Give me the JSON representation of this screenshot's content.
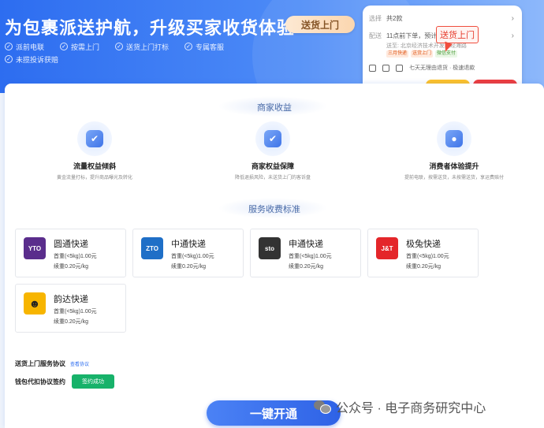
{
  "banner": {
    "title": "为包裹派送护航，升级买家收货体验",
    "tag": "送货上门",
    "features": [
      "派前电联",
      "按需上门",
      "送货上门打标",
      "专属客服",
      "未揽投诉获赔"
    ]
  },
  "phone": {
    "row1_label": "选择",
    "row1_value": "共2款",
    "row2_label": "配送",
    "row2_value": "11点前下单，预计",
    "address": "送至: 北京经济技术开发区经海路",
    "badges": [
      "三月快递",
      "送货上门",
      "微信支付"
    ],
    "bottom_text": "七天无理由退货 · 极速退款",
    "stamp": "送货上门"
  },
  "main": {
    "merchant_section_title": "商家收益",
    "benefits": [
      {
        "title": "流量权益倾斜",
        "desc": "黄金流量打标，提升商品曝光及转化"
      },
      {
        "title": "商家权益保障",
        "desc": "降低退损风险，未送货上门的客诉盘"
      },
      {
        "title": "消费者体验提升",
        "desc": "提前电联，按需送货，未按需送货，享运费赔付"
      }
    ],
    "fee_section_title": "服务收费标准",
    "couriers": [
      {
        "name": "圆通快递",
        "logo_text": "YTO",
        "line1": "首重(<5kg)1.00元",
        "line2": "续重0.20元/kg",
        "color": "#5a2d8c"
      },
      {
        "name": "中通快递",
        "logo_text": "ZTO",
        "line1": "首重(<5kg)1.00元",
        "line2": "续重0.20元/kg",
        "color": "#1f6fc7"
      },
      {
        "name": "申通快递",
        "logo_text": "sto",
        "line1": "首重(<5kg)1.00元",
        "line2": "续重0.20元/kg",
        "color": "#333333"
      },
      {
        "name": "极兔快递",
        "logo_text": "J&T",
        "line1": "首重(<5kg)1.00元",
        "line2": "续重0.20元/kg",
        "color": "#e4262a"
      },
      {
        "name": "韵达快递",
        "logo_text": "☻",
        "line1": "首重(<5kg)1.00元",
        "line2": "续重0.20元/kg",
        "color": "#f7b500"
      }
    ],
    "agreement_label": "送货上门服务协议",
    "agreement_link": "查看协议",
    "sign_label": "钱包代扣协议签约",
    "sign_status": "签约成功",
    "open_button": "一键开通"
  },
  "watermark": "公众号 · 电子商务研究中心"
}
